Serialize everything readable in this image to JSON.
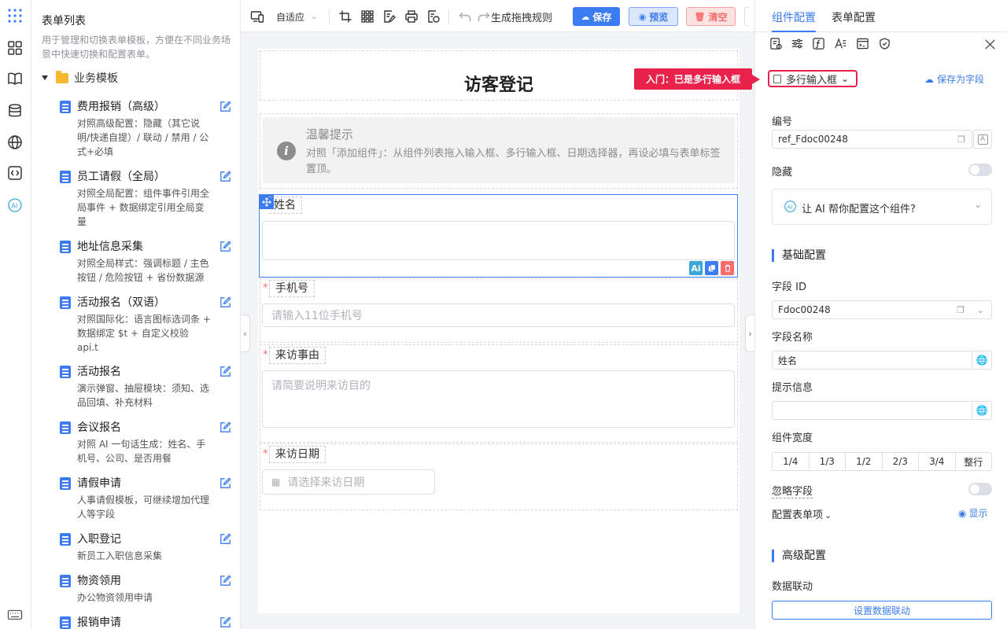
{
  "left_panel": {
    "title": "表单列表",
    "description": "用于管理和切换表单模板，方便在不同业务场景中快速切换和配置表单。",
    "folder": "业务模板",
    "templates": [
      {
        "name": "费用报销（高级）",
        "desc": "对照高级配置：隐藏（其它说明/快递自提）/ 联动 / 禁用 / 公式+必填"
      },
      {
        "name": "员工请假（全局）",
        "desc": "对照全局配置：组件事件引用全局事件 + 数据绑定引用全局变量"
      },
      {
        "name": "地址信息采集",
        "desc": "对照全局样式：强调标题 / 主色按钮 / 危险按钮 + 省份数据源"
      },
      {
        "name": "活动报名（双语）",
        "desc": "对照国际化：语言图标选词条 + 数据绑定 $t + 自定义校验 api.t"
      },
      {
        "name": "活动报名",
        "desc": "演示弹窗、抽屉模块：须知、选品回填、补充材料"
      },
      {
        "name": "会议报名",
        "desc": "对照 AI 一句话生成：姓名、手机号、公司、是否用餐"
      },
      {
        "name": "请假申请",
        "desc": "人事请假模板，可继续增加代理人等字段"
      },
      {
        "name": "入职登记",
        "desc": "新员工入职信息采集"
      },
      {
        "name": "物资领用",
        "desc": "办公物资领用申请"
      },
      {
        "name": "报销申请",
        "desc": ""
      }
    ]
  },
  "toolbar": {
    "adaptive": "自适应",
    "rules": "生成拖拽规则",
    "save": "保存",
    "preview": "预览",
    "clear": "清空"
  },
  "form": {
    "title": "访客登记",
    "tip_title": "温馨提示",
    "tip_text": "对照「添加组件」：从组件列表拖入输入框、多行输入框、日期选择器，再设必填与表单标签置顶。",
    "fields": [
      {
        "label": "姓名",
        "placeholder": "",
        "required": false
      },
      {
        "label": "手机号",
        "placeholder": "请输入11位手机号",
        "required": true
      },
      {
        "label": "来访事由",
        "placeholder": "请简要说明来访目的",
        "required": true
      },
      {
        "label": "来访日期",
        "placeholder": "请选择来访日期",
        "required": true
      }
    ],
    "ai_badge": "Ai",
    "required_mark": "*"
  },
  "annotation": "入门：已是多行输入框",
  "right_panel": {
    "tabs": [
      "组件配置",
      "表单配置"
    ],
    "component_type": "多行输入框",
    "save_as_field": "保存为字段",
    "id_label": "编号",
    "id_value": "ref_Fdoc00248",
    "hidden_label": "隐藏",
    "ai_config": "让 AI 帮你配置这个组件?",
    "basic_section": "基础配置",
    "field_id_label": "字段 ID",
    "field_id_value": "Fdoc00248",
    "field_name_label": "字段名称",
    "field_name_value": "姓名",
    "hint_label": "提示信息",
    "hint_value": "",
    "width_label": "组件宽度",
    "widths": [
      "1/4",
      "1/3",
      "1/2",
      "2/3",
      "3/4",
      "整行"
    ],
    "ignore_label": "忽略字段",
    "form_items_label": "配置表单项",
    "show_label": "显示",
    "advanced_section": "高级配置",
    "linkage_label": "数据联动",
    "linkage_button": "设置数据联动"
  }
}
